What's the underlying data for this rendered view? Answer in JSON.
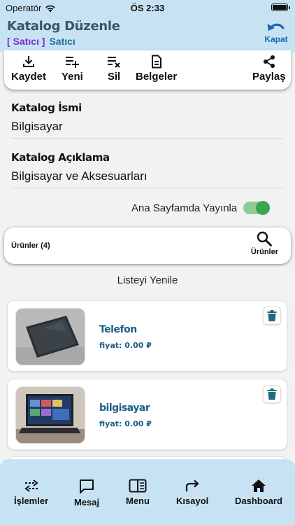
{
  "status": {
    "carrier": "Operatör",
    "time": "ÖS 2:33"
  },
  "header": {
    "title": "Katalog Düzenle",
    "role_bracket": "[ Satıcı ]",
    "role": "Satıcı",
    "close_label": "Kapat"
  },
  "toolbar": {
    "save": "Kaydet",
    "new": "Yeni",
    "delete": "Sil",
    "documents": "Belgeler",
    "share": "Paylaş"
  },
  "form": {
    "name_label": "Katalog İsmi",
    "name_value": "Bilgisayar",
    "desc_label": "Katalog Açıklama",
    "desc_value": "Bilgisayar ve Aksesuarları",
    "publish_label": "Ana Sayfamda Yayınla",
    "publish_on": true
  },
  "products": {
    "count_label": "Ürünler (4)",
    "search_label": "Ürünler",
    "refresh_label": "Listeyi Yenile",
    "items": [
      {
        "name": "Telefon",
        "price": "fiyat: 0.00 ₽"
      },
      {
        "name": "bilgisayar",
        "price": "fiyat: 0.00 ₽"
      }
    ]
  },
  "nav": {
    "operations": "İşlemler",
    "message": "Mesaj",
    "menu": "Menu",
    "shortcut": "Kısayol",
    "dashboard": "Dashboard"
  },
  "colors": {
    "header_bg": "#c7e3f3",
    "accent_blue": "#1d63b8",
    "product_text": "#1e5f86",
    "toggle_green": "#3aa655",
    "delete_icon": "#1e6b7e"
  }
}
